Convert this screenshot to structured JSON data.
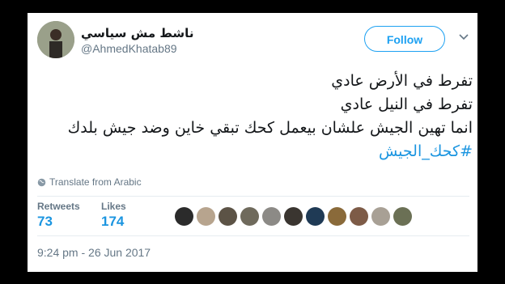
{
  "author": {
    "display_name": "ناشط مش سياسي",
    "handle": "@AhmedKhatab89"
  },
  "follow_label": "Follow",
  "tweet_lines": [
    "تفرط في الأرض عادي",
    "تفرط في النيل عادي",
    "انما تهين الجيش علشان بيعمل كحك تبقي خاين وضد جيش بلدك"
  ],
  "hashtag": "#كحك_الجيش",
  "translate_label": "Translate from Arabic",
  "stats": {
    "retweets_label": "Retweets",
    "retweets_value": "73",
    "likes_label": "Likes",
    "likes_value": "174"
  },
  "liker_avatars": [
    {
      "name": "liker-avatar-1",
      "color": "#2b2b2b"
    },
    {
      "name": "liker-avatar-2",
      "color": "#b7a48e"
    },
    {
      "name": "liker-avatar-3",
      "color": "#5c5346"
    },
    {
      "name": "liker-avatar-4",
      "color": "#6f6a5c"
    },
    {
      "name": "liker-avatar-5",
      "color": "#8c8a86"
    },
    {
      "name": "liker-avatar-6",
      "color": "#3a3530"
    },
    {
      "name": "liker-avatar-7",
      "color": "#1f3a55"
    },
    {
      "name": "liker-avatar-8",
      "color": "#8a6a3a"
    },
    {
      "name": "liker-avatar-9",
      "color": "#7d5b47"
    },
    {
      "name": "liker-avatar-10",
      "color": "#a8a095"
    },
    {
      "name": "liker-avatar-11",
      "color": "#6b7055"
    }
  ],
  "timestamp": "9:24 pm - 26 Jun 2017"
}
